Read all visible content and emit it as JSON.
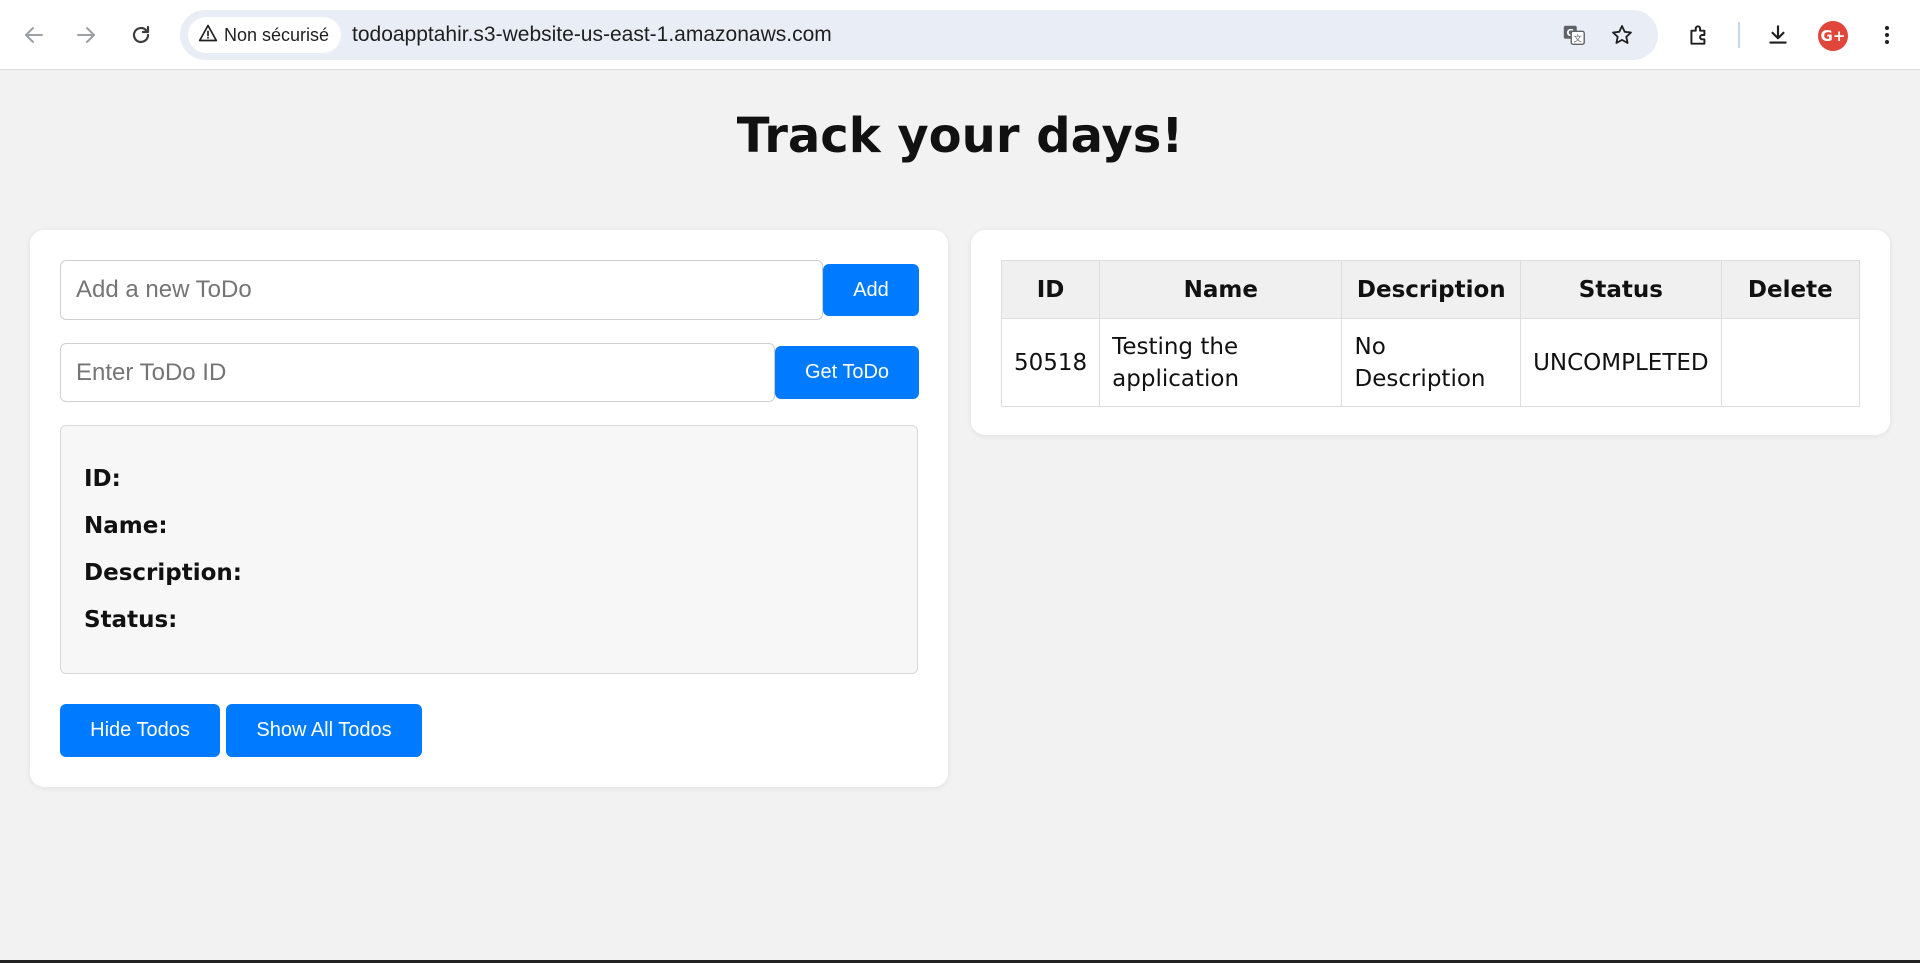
{
  "browser": {
    "security_label": "Non sécurisé",
    "url": "todoapptahir.s3-website-us-east-1.amazonaws.com",
    "avatar_letter": "G+",
    "icons": [
      "back-arrow-icon",
      "forward-arrow-icon",
      "reload-icon",
      "warning-triangle-icon",
      "translate-icon",
      "star-icon",
      "extensions-icon",
      "download-icon",
      "kebab-menu-icon"
    ]
  },
  "page": {
    "title": "Track your days!"
  },
  "form": {
    "new_todo_placeholder": "Add a new ToDo",
    "new_todo_value": "",
    "add_label": "Add",
    "todo_id_placeholder": "Enter ToDo ID",
    "todo_id_value": "",
    "get_label": "Get ToDo"
  },
  "details": {
    "id_label": "ID:",
    "name_label": "Name:",
    "description_label": "Description:",
    "status_label": "Status:"
  },
  "actions": {
    "hide_label": "Hide Todos",
    "show_all_label": "Show All Todos"
  },
  "table": {
    "headers": [
      "ID",
      "Name",
      "Description",
      "Status",
      "Delete"
    ],
    "rows": [
      {
        "id": "50518",
        "name": "Testing the application",
        "description": "No Description",
        "status": "UNCOMPLETED",
        "delete": ""
      }
    ]
  },
  "colors": {
    "accent": "#007bff",
    "page_bg": "#f2f2f2",
    "card_bg": "#ffffff"
  }
}
